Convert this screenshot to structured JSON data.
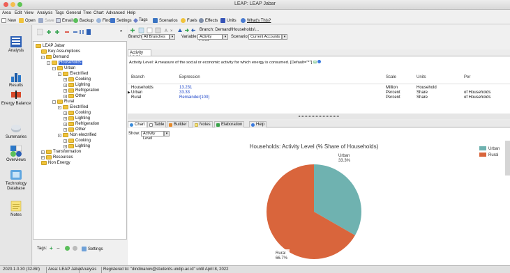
{
  "window": {
    "title": "LEAP: LEAP Jabar"
  },
  "menu": [
    "Area",
    "Edit",
    "View",
    "Analysis",
    "Tags",
    "General",
    "Tree",
    "Chart",
    "Advanced",
    "Help"
  ],
  "toolbar": {
    "new": "New",
    "open": "Open",
    "save": "Save",
    "email": "Email",
    "backup": "Backup",
    "find": "Find",
    "settings": "Settings",
    "tags": "Tags",
    "scenarios": "Scenarios",
    "fuels": "Fuels",
    "effects": "Effects",
    "units": "Units",
    "whats_this": "What's This?"
  },
  "nav": [
    "Analysis",
    "Results",
    "Energy Balance",
    "Summaries",
    "Overviews",
    "Technology Database",
    "Notes"
  ],
  "tree": {
    "nodes": [
      {
        "label": "LEAP Jabar",
        "depth": 0,
        "exp": ""
      },
      {
        "label": "Key Assumptions",
        "depth": 1,
        "exp": ""
      },
      {
        "label": "Demand",
        "depth": 1,
        "exp": "-"
      },
      {
        "label": "Households",
        "depth": 2,
        "exp": "-"
      },
      {
        "label": "Urban",
        "depth": 3,
        "exp": "-"
      },
      {
        "label": "Electrified",
        "depth": 4,
        "exp": "-"
      },
      {
        "label": "Cooking",
        "depth": 5,
        "exp": "+"
      },
      {
        "label": "Lighting",
        "depth": 5,
        "exp": "+"
      },
      {
        "label": "Refrigeration",
        "depth": 5,
        "exp": "+"
      },
      {
        "label": "Other",
        "depth": 5,
        "exp": "+"
      },
      {
        "label": "Rural",
        "depth": 3,
        "exp": "-"
      },
      {
        "label": "Electrified",
        "depth": 4,
        "exp": "-"
      },
      {
        "label": "Cooking",
        "depth": 5,
        "exp": "+"
      },
      {
        "label": "Lighting",
        "depth": 5,
        "exp": "+"
      },
      {
        "label": "Refrigeration",
        "depth": 5,
        "exp": "+"
      },
      {
        "label": "Other",
        "depth": 5,
        "exp": "+"
      },
      {
        "label": "Non electrified",
        "depth": 4,
        "exp": "-"
      },
      {
        "label": "Cooking",
        "depth": 5,
        "exp": "+"
      },
      {
        "label": "Lighting",
        "depth": 5,
        "exp": "+"
      },
      {
        "label": "Transformation",
        "depth": 1,
        "exp": "+"
      },
      {
        "label": "Resources",
        "depth": 1,
        "exp": "+"
      },
      {
        "label": "Non Energy",
        "depth": 1,
        "exp": ""
      }
    ],
    "selected_index": 3,
    "footer_tags": "Tags:",
    "footer_settings": "Settings"
  },
  "header": {
    "breadcrumb": "Branch: Demand\\Households\\...",
    "branch_label": "Branch:",
    "branch_value": "All Branches",
    "variable_label": "Variable:",
    "variable_value": "Activity Level",
    "scenario_label": "Scenario:",
    "scenario_value": "Current Accounts"
  },
  "tab_top": "Activity Level",
  "description": "Activity Level: A measure of the social or economic activity for which energy is consumed. [Default=\"*\"]",
  "grid": {
    "headers": [
      "Branch",
      "Expression",
      "Scale",
      "Units",
      "Per"
    ],
    "rows": [
      {
        "branch": "Households",
        "expr": "13.231",
        "scale": "Million",
        "units": "Household",
        "per": ""
      },
      {
        "branch": "Urban",
        "expr": "33.33",
        "scale": "Percent",
        "units": "Share",
        "per": "of Households"
      },
      {
        "branch": "Rural",
        "expr": "Remainder(100)",
        "scale": "Percent",
        "units": "Share",
        "per": "of Households"
      }
    ]
  },
  "lower_tabs": [
    "Chart",
    "Table",
    "Builder",
    "Notes",
    "Elaboration",
    "Help"
  ],
  "show_label": "Show:",
  "show_value": "Activity Level",
  "chart_data": {
    "type": "pie",
    "title": "Households: Activity Level (% Share of Households)",
    "labels": [
      "Urban",
      "Rural"
    ],
    "values": [
      33.3,
      66.7
    ],
    "colors": [
      "#6fb2b0",
      "#d9653c"
    ],
    "legend": "right"
  },
  "status": [
    "2020.1.0.30 (32-Bit)",
    "Area: LEAP Jabar",
    "Analysis",
    "Registered to: \"dindinanov@students.undip.ac.id\" until April 8, 2022"
  ]
}
